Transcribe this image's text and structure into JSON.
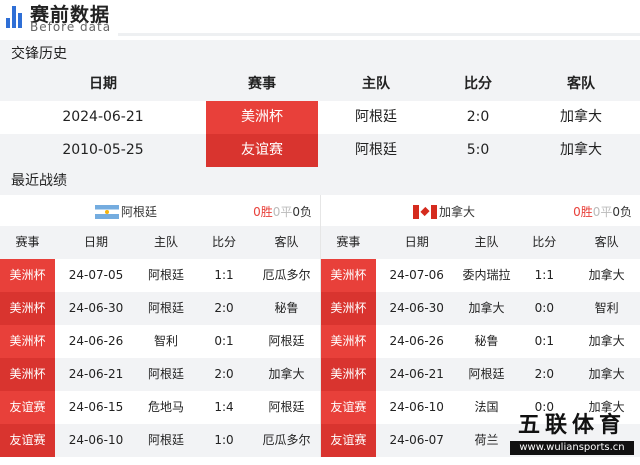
{
  "header": {
    "title": "赛前数据",
    "subtitle": "Before data"
  },
  "h2h": {
    "section_title": "交锋历史",
    "columns": [
      "日期",
      "赛事",
      "主队",
      "比分",
      "客队"
    ],
    "rows": [
      {
        "date": "2024-06-21",
        "comp": "美洲杯",
        "home": "阿根廷",
        "score": "2:0",
        "away": "加拿大"
      },
      {
        "date": "2010-05-25",
        "comp": "友谊赛",
        "home": "阿根廷",
        "score": "5:0",
        "away": "加拿大"
      }
    ]
  },
  "recent": {
    "section_title": "最近战绩",
    "columns": [
      "赛事",
      "日期",
      "主队",
      "比分",
      "客队"
    ],
    "left": {
      "team": "阿根廷",
      "record": {
        "wins": "0胜",
        "draws": "0平",
        "losses": "0负"
      },
      "rows": [
        {
          "comp": "美洲杯",
          "date": "24-07-05",
          "home": "阿根廷",
          "score": "1:1",
          "away": "厄瓜多尔"
        },
        {
          "comp": "美洲杯",
          "date": "24-06-30",
          "home": "阿根廷",
          "score": "2:0",
          "away": "秘鲁"
        },
        {
          "comp": "美洲杯",
          "date": "24-06-26",
          "home": "智利",
          "score": "0:1",
          "away": "阿根廷"
        },
        {
          "comp": "美洲杯",
          "date": "24-06-21",
          "home": "阿根廷",
          "score": "2:0",
          "away": "加拿大"
        },
        {
          "comp": "友谊赛",
          "date": "24-06-15",
          "home": "危地马",
          "score": "1:4",
          "away": "阿根廷"
        },
        {
          "comp": "友谊赛",
          "date": "24-06-10",
          "home": "阿根廷",
          "score": "1:0",
          "away": "厄瓜多尔"
        }
      ]
    },
    "right": {
      "team": "加拿大",
      "record": {
        "wins": "0胜",
        "draws": "0平",
        "losses": "0负"
      },
      "rows": [
        {
          "comp": "美洲杯",
          "date": "24-07-06",
          "home": "委内瑞拉",
          "score": "1:1",
          "away": "加拿大"
        },
        {
          "comp": "美洲杯",
          "date": "24-06-30",
          "home": "加拿大",
          "score": "0:0",
          "away": "智利"
        },
        {
          "comp": "美洲杯",
          "date": "24-06-26",
          "home": "秘鲁",
          "score": "0:1",
          "away": "加拿大"
        },
        {
          "comp": "美洲杯",
          "date": "24-06-21",
          "home": "阿根廷",
          "score": "2:0",
          "away": "加拿大"
        },
        {
          "comp": "友谊赛",
          "date": "24-06-10",
          "home": "法国",
          "score": "0:0",
          "away": "加拿大"
        },
        {
          "comp": "友谊赛",
          "date": "24-06-07",
          "home": "荷兰",
          "score": "",
          "away": ""
        }
      ]
    }
  },
  "watermark": {
    "title": "五联体育",
    "url": "www.wuliansports.cn"
  },
  "colors": {
    "accent_red": "#e8403a",
    "logo_blue": "#2f6fd6",
    "zebra_gray": "#f2f3f5"
  }
}
